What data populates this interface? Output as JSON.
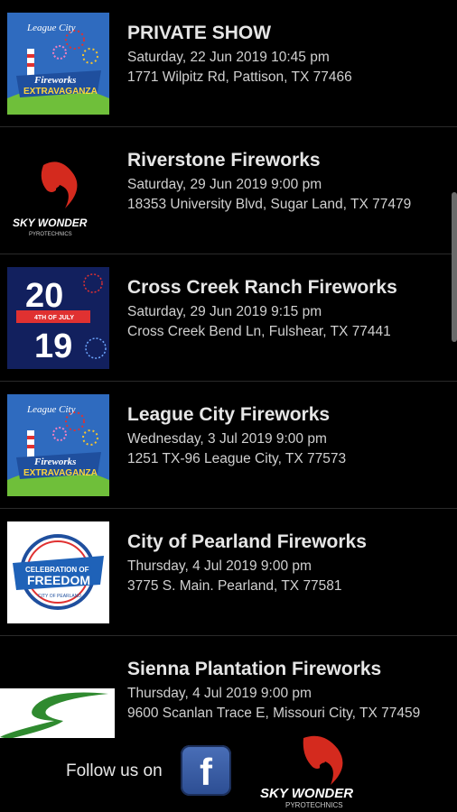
{
  "events": [
    {
      "title": "PRIVATE SHOW",
      "date": "Saturday, 22 Jun 2019 10:45 pm",
      "address": "1771 Wilpitz Rd, Pattison, TX 77466",
      "thumb": "fireworks-extravaganza-logo"
    },
    {
      "title": "Riverstone Fireworks",
      "date": "Saturday, 29 Jun 2019 9:00 pm",
      "address": "18353 University Blvd, Sugar Land, TX 77479",
      "thumb": "sky-wonder-logo"
    },
    {
      "title": "Cross Creek Ranch Fireworks",
      "date": "Saturday, 29 Jun 2019 9:15 pm",
      "address": "Cross Creek Bend Ln, Fulshear, TX 77441",
      "thumb": "2019-4th-of-july-poster"
    },
    {
      "title": "League City Fireworks",
      "date": "Wednesday, 3 Jul 2019 9:00 pm",
      "address": "1251 TX-96 League City, TX 77573",
      "thumb": "fireworks-extravaganza-logo"
    },
    {
      "title": "City of Pearland Fireworks",
      "date": "Thursday, 4 Jul 2019 9:00 pm",
      "address": "3775 S. Main. Pearland, TX 77581",
      "thumb": "celebration-of-freedom-logo"
    },
    {
      "title": "Sienna Plantation Fireworks",
      "date": "Thursday, 4 Jul 2019 9:00 pm",
      "address": "9600 Scanlan Trace E, Missouri City, TX 77459",
      "thumb": "sienna-logo"
    }
  ],
  "thumbs": {
    "league_city": "League City",
    "fw1": "Fireworks",
    "fw2": "EXTRAVAGANZA",
    "sky_wonder": "SKY WONDER",
    "pyro": "PYROTECHNICS",
    "y20": "20",
    "y19": "19",
    "july": "4TH OF JULY",
    "cel1": "CELEBRATION OF",
    "cel2": "FREEDOM",
    "cel3": "CITY OF PEARLAND"
  },
  "footer": {
    "follow_label": "Follow us on",
    "facebook_glyph": "f",
    "brand": "SKY WONDER",
    "brand_sub": "PYROTECHNICS"
  },
  "colors": {
    "background": "#000000",
    "title": "#e6e6e6",
    "text": "#d0d0d0",
    "facebook": "#3b5998",
    "brand_red": "#d42a1e"
  }
}
